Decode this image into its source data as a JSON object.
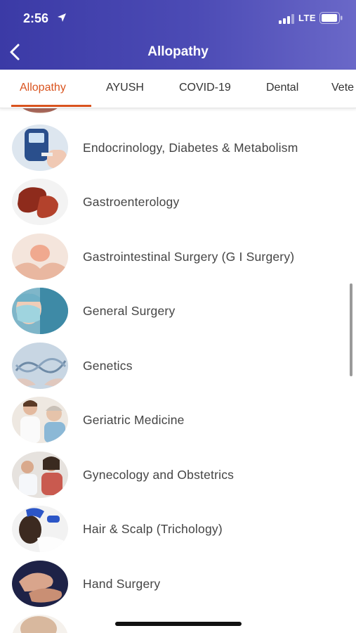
{
  "status_bar": {
    "time": "2:56",
    "network": "LTE"
  },
  "header": {
    "title": "Allopathy"
  },
  "tabs": [
    {
      "label": "Allopathy",
      "active": true
    },
    {
      "label": "AYUSH",
      "active": false
    },
    {
      "label": "COVID-19",
      "active": false
    },
    {
      "label": "Dental",
      "active": false
    },
    {
      "label": "Vete",
      "active": false
    }
  ],
  "colors": {
    "header_start": "#3b3aa6",
    "header_end": "#6a68c8",
    "accent": "#d9531e"
  },
  "specialties": [
    {
      "label": "Endocrinology, Diabetes & Metabolism",
      "icon": "glucometer-image"
    },
    {
      "label": "Gastroenterology",
      "icon": "stomach-image"
    },
    {
      "label": "Gastrointestinal Surgery (G I Surgery)",
      "icon": "hands-stomach-image"
    },
    {
      "label": "General Surgery",
      "icon": "surgeon-image"
    },
    {
      "label": "Genetics",
      "icon": "dna-image"
    },
    {
      "label": "Geriatric Medicine",
      "icon": "doctor-elderly-image"
    },
    {
      "label": "Gynecology and Obstetrics",
      "icon": "gynecology-image"
    },
    {
      "label": "Hair & Scalp (Trichology)",
      "icon": "scalp-image"
    },
    {
      "label": "Hand Surgery",
      "icon": "hands-image"
    }
  ]
}
